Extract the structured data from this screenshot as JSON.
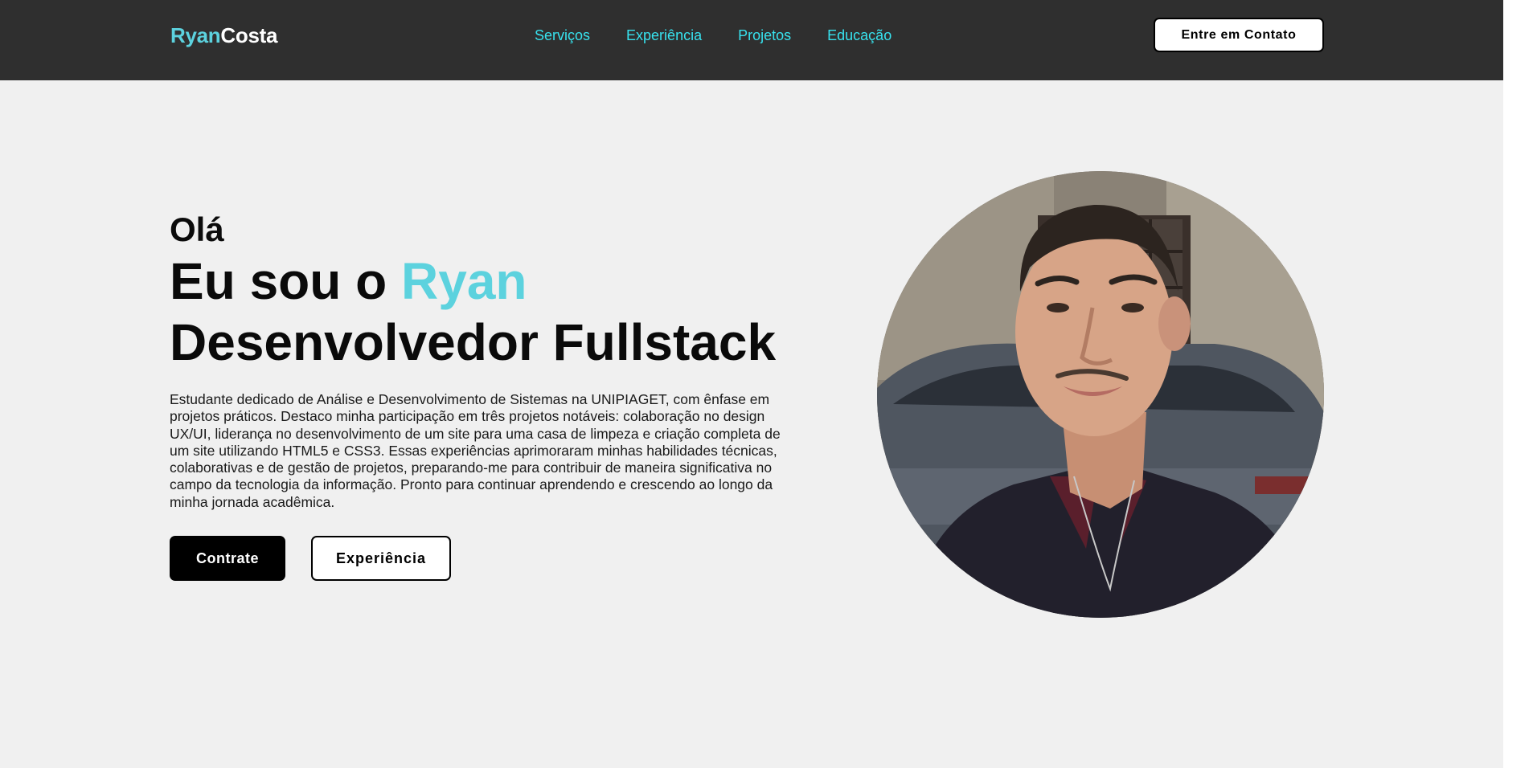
{
  "header": {
    "logo_first": "Ryan",
    "logo_last": "Costa",
    "nav": [
      {
        "label": "Serviços"
      },
      {
        "label": "Experiência"
      },
      {
        "label": "Projetos"
      },
      {
        "label": "Educação"
      }
    ],
    "contact_label": "Entre em Contato"
  },
  "hero": {
    "greeting": "Olá",
    "intro_prefix": "Eu sou o ",
    "name": "Ryan",
    "role": "Desenvolvedor Fullstack",
    "bio": "Estudante dedicado de Análise e Desenvolvimento de Sistemas na UNIPIAGET, com ênfase em projetos práticos. Destaco minha participação em três projetos notáveis: colaboração no design UX/UI, liderança no desenvolvimento de um site para uma casa de limpeza e criação completa de um site utilizando HTML5 e CSS3. Essas experiências aprimoraram minhas habilidades técnicas, colaborativas e de gestão de projetos, preparando-me para contribuir de maneira significativa no campo da tecnologia da informação. Pronto para continuar aprendendo e crescendo ao longo da minha jornada acadêmica.",
    "primary_cta": "Contrate",
    "secondary_cta": "Experiência"
  },
  "colors": {
    "accent": "#5cd2de",
    "nav_link": "#37e2ee",
    "header_bg": "#2f2f2f",
    "page_bg": "#f0f0f0"
  }
}
